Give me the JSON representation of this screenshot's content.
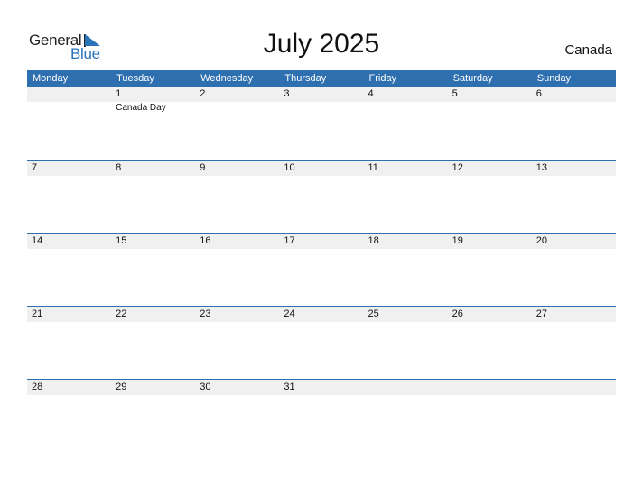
{
  "logo": {
    "word1": "General",
    "word2": "Blue"
  },
  "title": "July 2025",
  "country": "Canada",
  "weekdays": [
    "Monday",
    "Tuesday",
    "Wednesday",
    "Thursday",
    "Friday",
    "Saturday",
    "Sunday"
  ],
  "weeks": [
    {
      "days": [
        "",
        "1",
        "2",
        "3",
        "4",
        "5",
        "6"
      ],
      "events": [
        "",
        "Canada Day",
        "",
        "",
        "",
        "",
        ""
      ]
    },
    {
      "days": [
        "7",
        "8",
        "9",
        "10",
        "11",
        "12",
        "13"
      ],
      "events": [
        "",
        "",
        "",
        "",
        "",
        "",
        ""
      ]
    },
    {
      "days": [
        "14",
        "15",
        "16",
        "17",
        "18",
        "19",
        "20"
      ],
      "events": [
        "",
        "",
        "",
        "",
        "",
        "",
        ""
      ]
    },
    {
      "days": [
        "21",
        "22",
        "23",
        "24",
        "25",
        "26",
        "27"
      ],
      "events": [
        "",
        "",
        "",
        "",
        "",
        "",
        ""
      ]
    },
    {
      "days": [
        "28",
        "29",
        "30",
        "31",
        "",
        "",
        ""
      ],
      "events": [
        "",
        "",
        "",
        "",
        "",
        "",
        ""
      ]
    }
  ],
  "colors": {
    "header": "#2e6fb0",
    "brand_blue": "#2a73b8",
    "date_strip": "#f0f0f0"
  }
}
